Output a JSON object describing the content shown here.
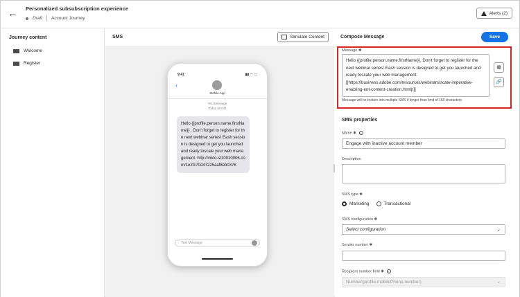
{
  "header": {
    "back_icon": "arrow-left-icon",
    "title": "Personalized subsubscription experience",
    "status": "Draft",
    "journey": "Account Journey",
    "alerts": "Alerts (2)"
  },
  "left": {
    "title": "Journey content",
    "items": [
      {
        "label": "Welcome",
        "icon": "mail-icon"
      },
      {
        "label": "Register",
        "icon": "mail-icon"
      }
    ]
  },
  "center": {
    "title": "SMS",
    "simulate": "Simulate Content",
    "phone": {
      "time": "9:41",
      "status": "▮▮ ◠ ▭",
      "app_name": "Mobile App",
      "meta1": "Text Message",
      "meta2": "Today at 9:41",
      "message": "Hello {{profile.person.name.firstName}} , Don't forget to register for the next webinar series! Eash session is designed to get you launched and ready toscale your web management.  http://mkto-st10010006.com/1e2fc70d47225aaf8eb0378",
      "input_placeholder": "Text Message"
    }
  },
  "right": {
    "title": "Compose Message",
    "save": "Save",
    "message_label": "Message ✱",
    "message_value": "Hello {{profile.person.name.firstName}}, Don't forget to register for the next webinar series! Eash session is designed to get you launched and ready toscale your web management. [[https://business.adobe.com/resources/webinars/scale-imperative-enabling-ent-content-creation.html|t]]",
    "hint": "Message will be broken into multiple SMS if longer than limit of 160 characters",
    "section": "SMS properties",
    "name_label": "Name ✱",
    "name_value": "Engage with inactive account member",
    "description_label": "Description",
    "description_value": "",
    "type_label": "SMS type ✱",
    "type_marketing": "Marketing",
    "type_transactional": "Transactional",
    "config_label": "SMS configuration ✱",
    "config_value": "Select configuration",
    "sender_label": "Sender number ✱",
    "sender_value": "",
    "recipient_label": "Recipient number field ✱",
    "recipient_value": "Number(profile.mobilePhone.number)"
  }
}
